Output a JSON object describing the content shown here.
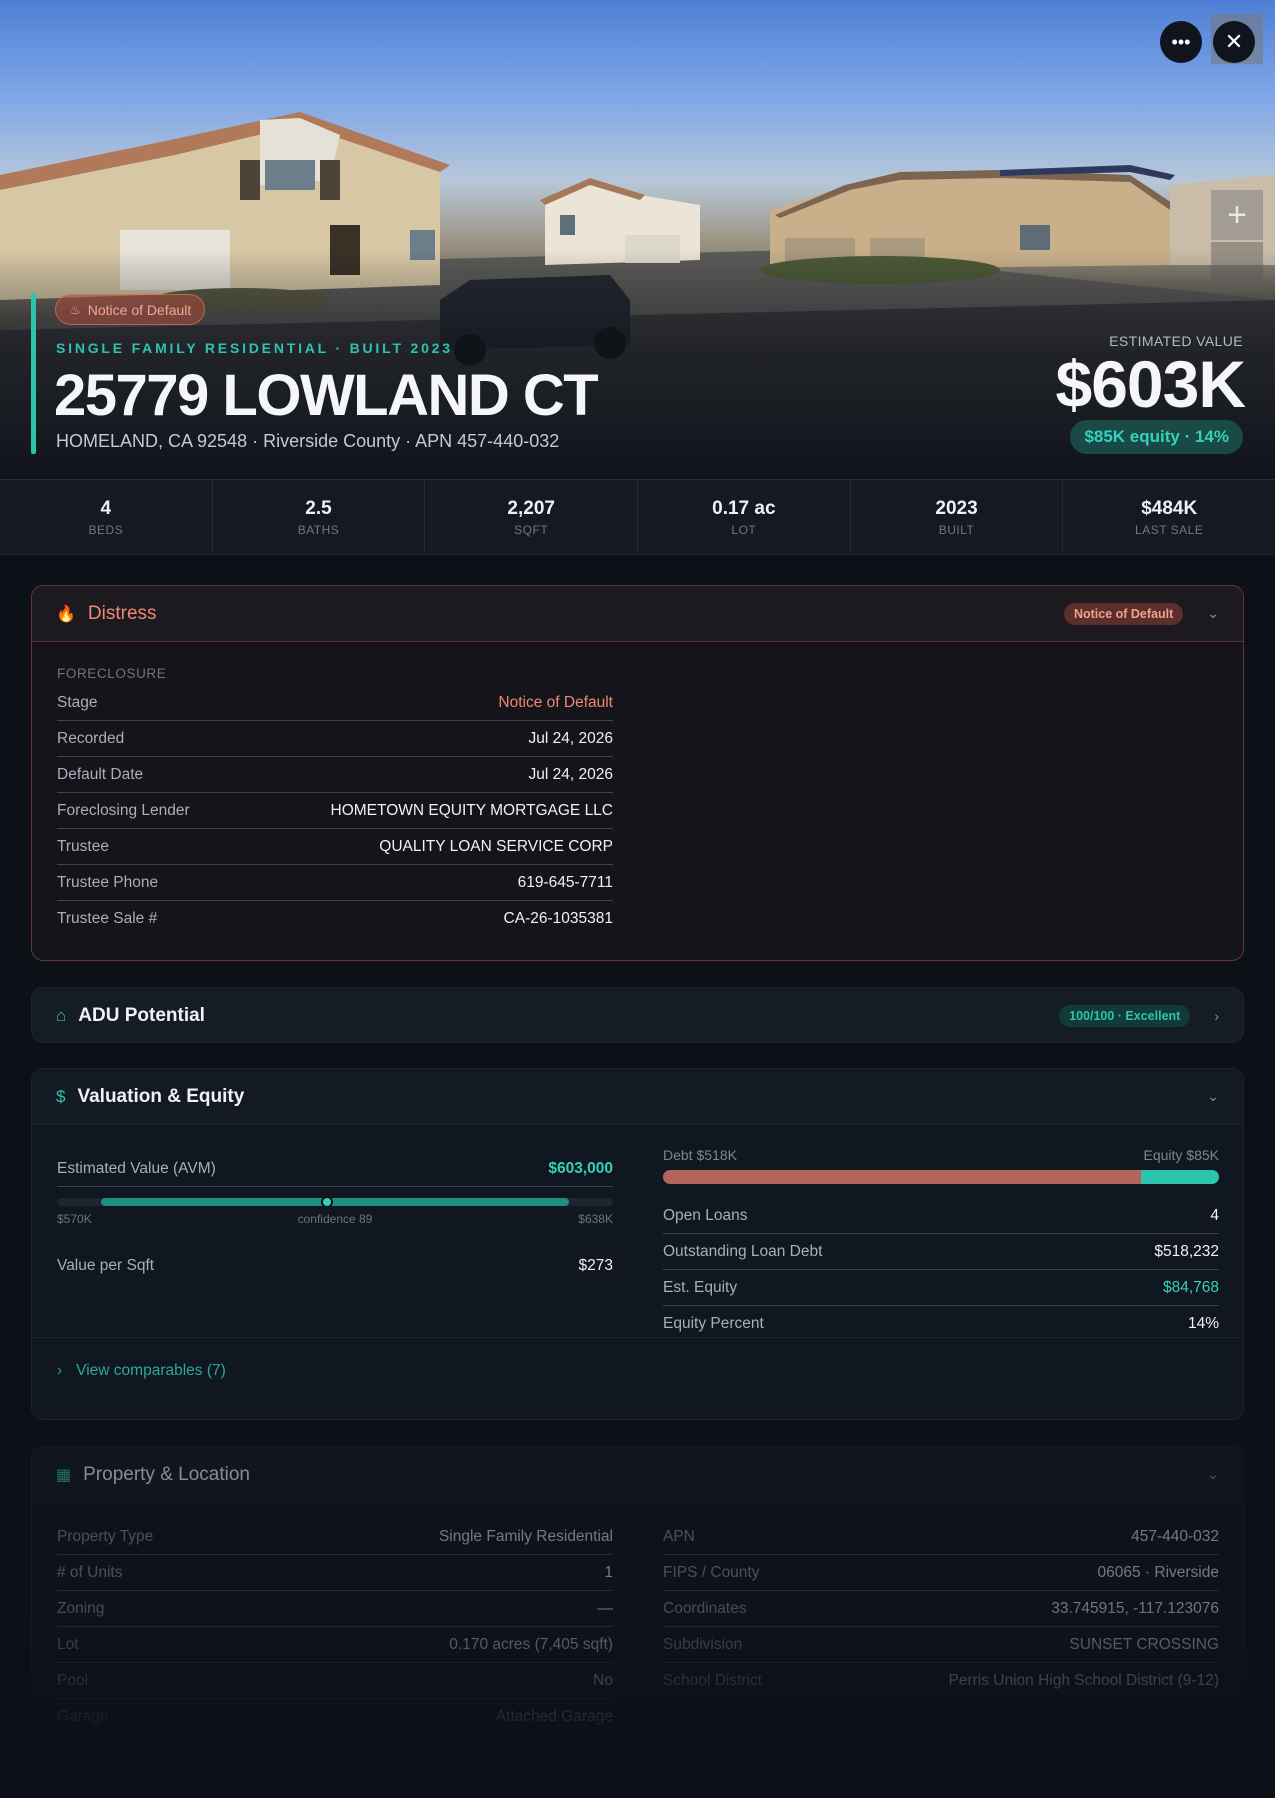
{
  "hero": {
    "distress_badge": "Notice of Default",
    "subtitle": "SINGLE FAMILY RESIDENTIAL · BUILT 2023",
    "address": "25779 LOWLAND CT",
    "location": "HOMELAND, CA 92548 · Riverside County · APN 457-440-032",
    "estimated_value_label": "ESTIMATED VALUE",
    "estimated_value": "$603K",
    "equity_pill": "$85K equity · 14%",
    "more_icon": "ellipsis-icon",
    "close_icon": "close-icon",
    "zoom_icon": "plus-icon"
  },
  "stats": [
    {
      "value": "4",
      "label": "BEDS"
    },
    {
      "value": "2.5",
      "label": "BATHS"
    },
    {
      "value": "2,207",
      "label": "SQFT"
    },
    {
      "value": "0.17 ac",
      "label": "LOT"
    },
    {
      "value": "2023",
      "label": "BUILT"
    },
    {
      "value": "$484K",
      "label": "LAST SALE"
    }
  ],
  "distress": {
    "title": "Distress",
    "icon": "flame-icon",
    "badge": "Notice of Default",
    "section_label": "FORECLOSURE",
    "rows": [
      {
        "k": "Stage",
        "v": "Notice of Default"
      },
      {
        "k": "Recorded",
        "v": "Jul 24, 2026"
      },
      {
        "k": "Default Date",
        "v": "Jul 24, 2026"
      },
      {
        "k": "Foreclosing Lender",
        "v": "HOMETOWN EQUITY MORTGAGE LLC"
      },
      {
        "k": "Trustee",
        "v": "QUALITY LOAN SERVICE CORP"
      },
      {
        "k": "Trustee Phone",
        "v": "619-645-7711"
      },
      {
        "k": "Trustee Sale #",
        "v": "CA-26-1035381"
      }
    ]
  },
  "adu": {
    "title": "ADU Potential",
    "icon": "home-icon",
    "badge": "100/100 · Excellent"
  },
  "valuation": {
    "title": "Valuation & Equity",
    "icon": "dollar-icon",
    "avm_label": "Estimated Value (AVM)",
    "avm_value": "$603,000",
    "range_low": "$570K",
    "range_high": "$638K",
    "confidence_label": "confidence 89",
    "range": {
      "min": 570000,
      "max": 638000,
      "value": 603000,
      "confidence_start_fraction": 0.08,
      "confidence_end_fraction": 0.92
    },
    "per_sqft_label": "Value per Sqft",
    "per_sqft_value": "$273",
    "debt_label": "Debt $518K",
    "equity_label": "Equity $85K",
    "debt_fraction": 0.86,
    "rows": [
      {
        "k": "Open Loans",
        "v": "4"
      },
      {
        "k": "Outstanding Loan Debt",
        "v": "$518,232"
      },
      {
        "k": "Est. Equity",
        "v": "$84,768"
      },
      {
        "k": "Equity Percent",
        "v": "14%"
      }
    ],
    "view_comps": "View comparables (7)"
  },
  "property": {
    "title": "Property & Location",
    "icon": "building-icon",
    "left_rows": [
      {
        "k": "Property Type",
        "v": "Single Family Residential"
      },
      {
        "k": "# of Units",
        "v": "1"
      },
      {
        "k": "Zoning",
        "v": "—"
      },
      {
        "k": "Lot",
        "v": "0.170 acres (7,405 sqft)"
      },
      {
        "k": "Pool",
        "v": "No"
      },
      {
        "k": "Garage",
        "v": "Attached Garage"
      }
    ],
    "right_rows": [
      {
        "k": "APN",
        "v": "457-440-032"
      },
      {
        "k": "FIPS / County",
        "v": "06065 · Riverside"
      },
      {
        "k": "Coordinates",
        "v": "33.745915, -117.123076"
      },
      {
        "k": "Subdivision",
        "v": "SUNSET CROSSING"
      },
      {
        "k": "School District",
        "v": "Perris Union High School District (9-12)"
      }
    ]
  },
  "colors": {
    "accent": "#2cc4ad",
    "distress": "#f08773",
    "debt": "#b2655b",
    "background": "#0c1017"
  }
}
